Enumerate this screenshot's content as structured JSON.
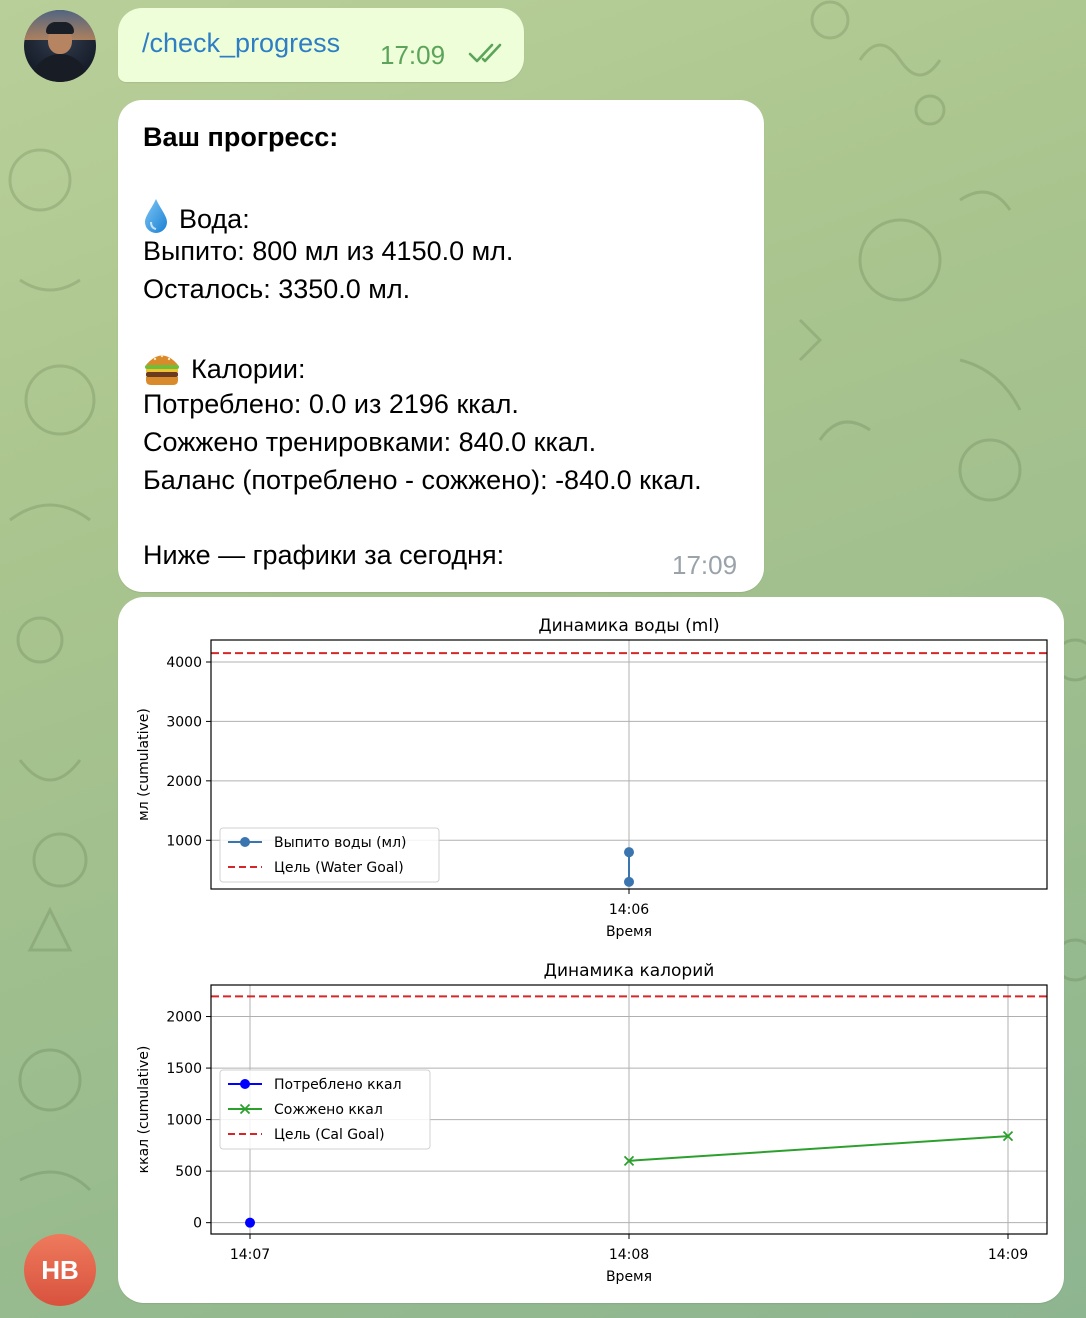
{
  "outgoing": {
    "command": "/check_progress",
    "time": "17:09"
  },
  "report": {
    "title": "Ваш прогресс:",
    "water_header": "Вода:",
    "water_drunk": "Выпито: 800 мл из 4150.0 мл.",
    "water_left": "Осталось: 3350.0 мл.",
    "cal_header": "Калории:",
    "cal_consumed": "Потреблено: 0.0 из 2196 ккал.",
    "cal_burned": "Сожжено тренировками: 840.0 ккал.",
    "cal_balance": "Баланс (потреблено - сожжено): -840.0 ккал.",
    "footer": "Ниже — графики за сегодня:",
    "time": "17:09",
    "icons": [
      "water-drop-icon",
      "burger-icon"
    ]
  },
  "sender_initials": "HB",
  "chart_data": [
    {
      "type": "line",
      "title": "Динамика воды (ml)",
      "xlabel": "Время",
      "ylabel": "мл (cumulative)",
      "x_ticks": [
        "14:06"
      ],
      "y_ticks": [
        "1000",
        "2000",
        "3000",
        "4000"
      ],
      "ylim": [
        180,
        4370
      ],
      "grid": true,
      "legend_position": "lower-left",
      "series": [
        {
          "name": "Выпито воды (мл)",
          "style": "line-marker",
          "color": "#3b75af",
          "points": [
            [
              "14:06",
              300
            ],
            [
              "14:06",
              800
            ]
          ]
        },
        {
          "name": "Цель (Water Goal)",
          "style": "dashed",
          "color": "#d62728",
          "value": 4150
        }
      ]
    },
    {
      "type": "line",
      "title": "Динамика калорий",
      "xlabel": "Время",
      "ylabel": "ккал (cumulative)",
      "x_ticks": [
        "14:07",
        "14:08",
        "14:09"
      ],
      "y_ticks": [
        "0",
        "500",
        "1000",
        "1500",
        "2000"
      ],
      "ylim": [
        -110,
        2306
      ],
      "grid": true,
      "legend_position": "center-left",
      "series": [
        {
          "name": "Потреблено ккал",
          "style": "marker",
          "color": "#0000ff",
          "points": [
            [
              "14:07",
              0
            ]
          ]
        },
        {
          "name": "Сожжено ккал",
          "style": "line-x",
          "color": "#2ca02c",
          "points": [
            [
              "14:08",
              600
            ],
            [
              "14:09",
              840
            ]
          ]
        },
        {
          "name": "Цель (Cal Goal)",
          "style": "dashed",
          "color": "#d62728",
          "value": 2196
        }
      ]
    }
  ]
}
